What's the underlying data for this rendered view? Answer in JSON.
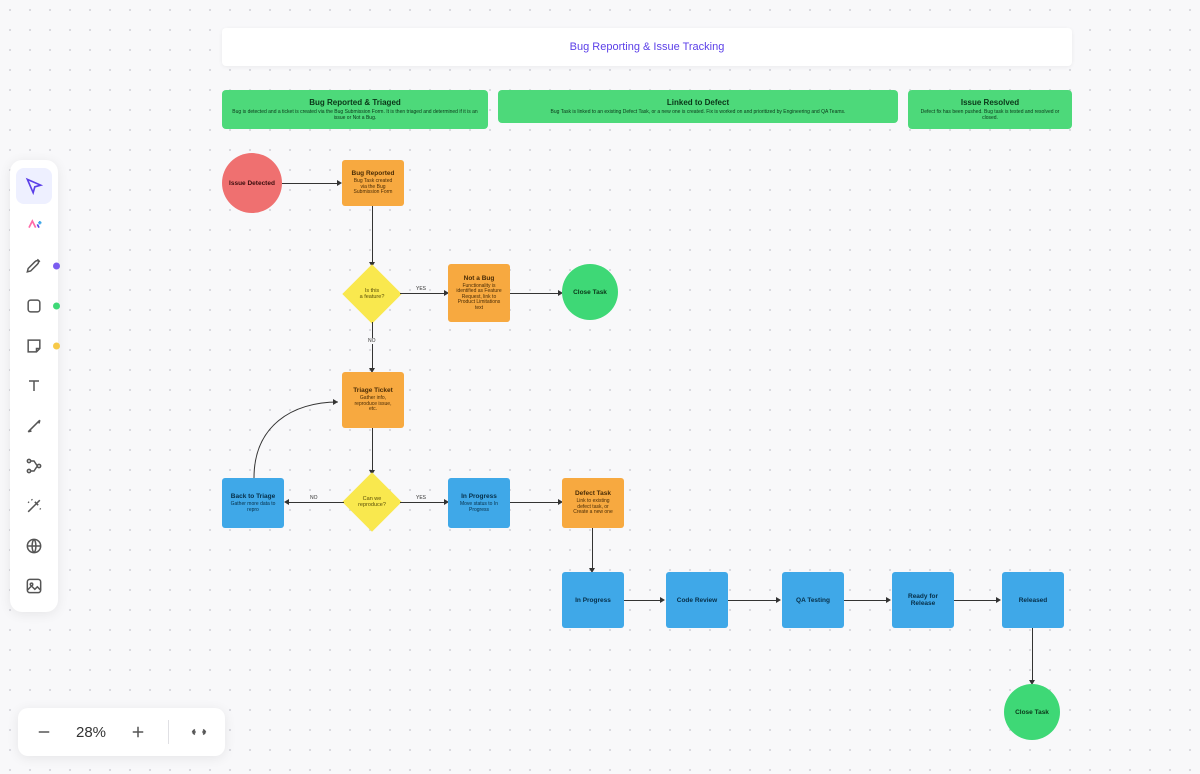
{
  "title": "Bug Reporting & Issue Tracking",
  "headers": {
    "reported": {
      "title": "Bug Reported & Triaged",
      "sub": "Bug is detected and a ticket is created via the Bug Submission Form. It is then triaged and determined if it is an issue or Not a Bug."
    },
    "linked": {
      "title": "Linked to Defect",
      "sub": "Bug Task is linked to an existing Defect Task, or a new one is created. Fix is worked on and prioritized by Engineering and QA Teams."
    },
    "resolved": {
      "title": "Issue Resolved",
      "sub": "Defect fix has been pushed. Bug task is tested and resolved or closed."
    }
  },
  "nodes": {
    "issue_detected": "Issue Detected",
    "bug_reported": {
      "title": "Bug Reported",
      "sub": "Bug Task created via the Bug Submission Form"
    },
    "is_bug": {
      "l1": "Is this",
      "l2": "a feature?"
    },
    "not_a_bug": {
      "title": "Not a Bug",
      "sub": "Functionality is identified as Feature Request, link to Product Limitations text"
    },
    "close_task_1": "Close Task",
    "triage_ticket": {
      "title": "Triage Ticket",
      "sub": "Gather info, reproduce issue, etc."
    },
    "can_reproduce": {
      "l1": "Can we",
      "l2": "reproduce?"
    },
    "back_to_triage": {
      "title": "Back to Triage",
      "sub": "Gather more data to repro"
    },
    "in_progress_1": {
      "title": "In Progress",
      "sub": "Move status to In Progress"
    },
    "defect_task": {
      "title": "Defect Task",
      "sub": "Link to existing defect task, or Create a new one"
    },
    "in_progress_2": "In Progress",
    "code_review": "Code Review",
    "qa_testing": "QA Testing",
    "ready_release": "Ready for Release",
    "released": "Released",
    "close_task_2": "Close Task"
  },
  "labels": {
    "yes": "YES",
    "no": "NO"
  },
  "zoom": "28%",
  "tool_dots": {
    "pen": "#7a5cf0",
    "shape": "#3ed876",
    "note": "#f7c948"
  }
}
